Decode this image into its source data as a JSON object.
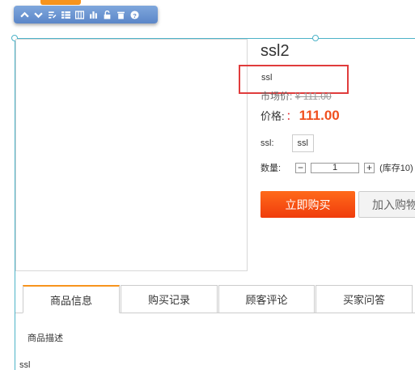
{
  "toolbar": {
    "icons": [
      "chevron-up-icon",
      "chevron-down-icon",
      "edit-icon",
      "list-icon",
      "columns-icon",
      "chart-icon",
      "unlock-icon",
      "delete-icon",
      "help-icon"
    ]
  },
  "product": {
    "title": "ssl2",
    "subtitle": "ssl",
    "market_price_label": "市场价:",
    "market_price_value": "¥ 111.00",
    "price_label": "价格:",
    "price_colon": "：",
    "price_value": "111.00",
    "spec_label": "ssl:",
    "spec_option": "ssl",
    "qty_label": "数量:",
    "qty_minus": "−",
    "qty_value": "1",
    "qty_plus": "+",
    "stock_text": "(库存10)",
    "buy_label": "立即购买",
    "cart_label": "加入购物车"
  },
  "tabs": [
    {
      "label": "商品信息"
    },
    {
      "label": "购买记录"
    },
    {
      "label": "顾客评论"
    },
    {
      "label": "买家问答"
    }
  ],
  "content": {
    "desc_label": "商品描述",
    "desc_text": "ssl"
  },
  "colors": {
    "accent": "#f7941d",
    "price": "#f0501e",
    "highlight": "#e03c3c",
    "guide": "#4db3c8"
  }
}
